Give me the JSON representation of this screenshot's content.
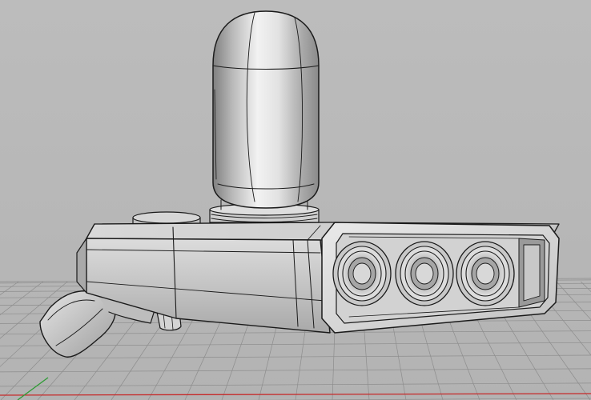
{
  "viewport": {
    "background_color": "#b9b9b9",
    "grid_color": "#8d8d8d",
    "model_shade_color": "#c9c9c9",
    "model_edge_color": "#1a1a1a",
    "axis_x_color": "#c62828",
    "axis_y_color": "#2e9b34"
  },
  "model": {
    "parts": [
      "capsule-tank",
      "tank-collar",
      "round-knob",
      "main-body",
      "front-panel",
      "barrel-ports",
      "trigger",
      "grip-handle"
    ],
    "barrel_count": 3
  }
}
